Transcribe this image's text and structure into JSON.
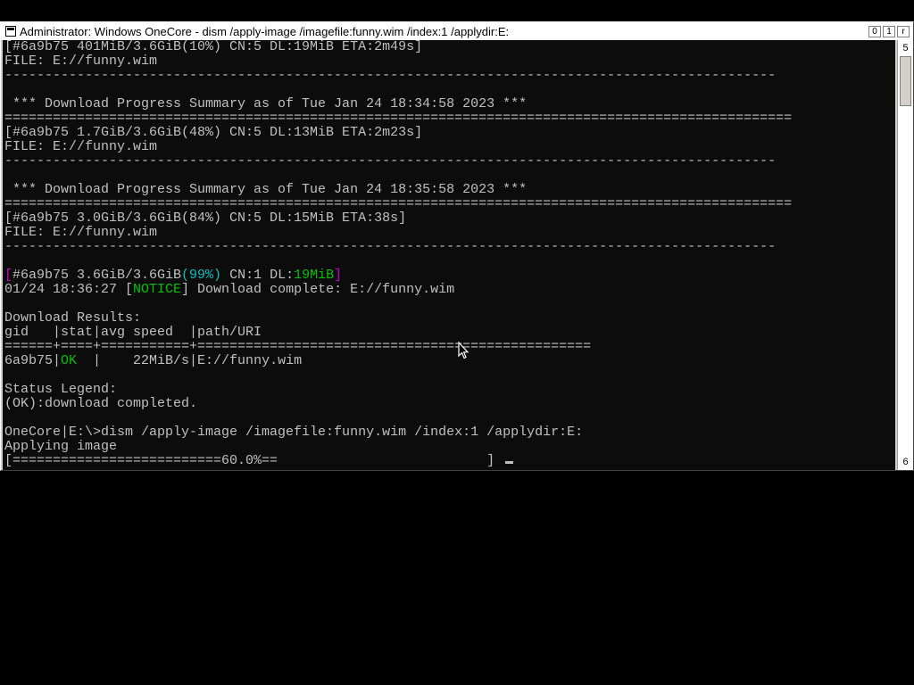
{
  "window": {
    "title": "Administrator:  Windows OneCore - dism  /apply-image /imagefile:funny.wim /index:1 /applydir:E:",
    "buttons": [
      "0",
      "1",
      "r"
    ]
  },
  "scrollbar": {
    "top_label": "5",
    "bottom_label": "6"
  },
  "console": {
    "lines": [
      [
        {
          "t": "[#6a9b75 401MiB/3.6GiB(10%) CN:5 DL:19MiB ETA:2m49s]",
          "c": ""
        }
      ],
      [
        {
          "t": "FILE: E://funny.wim",
          "c": ""
        }
      ],
      [
        {
          "t": "------------------------------------------------------------------------------------------------",
          "c": ""
        }
      ],
      [
        {
          "t": "",
          "c": ""
        }
      ],
      [
        {
          "t": " *** Download Progress Summary as of Tue Jan 24 18:34:58 2023 ***",
          "c": ""
        }
      ],
      [
        {
          "t": "==================================================================================================",
          "c": ""
        }
      ],
      [
        {
          "t": "[#6a9b75 1.7GiB/3.6GiB(48%) CN:5 DL:13MiB ETA:2m23s]",
          "c": ""
        }
      ],
      [
        {
          "t": "FILE: E://funny.wim",
          "c": ""
        }
      ],
      [
        {
          "t": "------------------------------------------------------------------------------------------------",
          "c": ""
        }
      ],
      [
        {
          "t": "",
          "c": ""
        }
      ],
      [
        {
          "t": " *** Download Progress Summary as of Tue Jan 24 18:35:58 2023 ***",
          "c": ""
        }
      ],
      [
        {
          "t": "==================================================================================================",
          "c": ""
        }
      ],
      [
        {
          "t": "[#6a9b75 3.0GiB/3.6GiB(84%) CN:5 DL:15MiB ETA:38s]",
          "c": ""
        }
      ],
      [
        {
          "t": "FILE: E://funny.wim",
          "c": ""
        }
      ],
      [
        {
          "t": "------------------------------------------------------------------------------------------------",
          "c": ""
        }
      ],
      [
        {
          "t": "",
          "c": ""
        }
      ],
      [
        {
          "t": "[",
          "c": "c-magenta"
        },
        {
          "t": "#6a9b75 3.6GiB/3.6GiB",
          "c": ""
        },
        {
          "t": "(99%)",
          "c": "c-cyan"
        },
        {
          "t": " CN:1 DL:",
          "c": ""
        },
        {
          "t": "19MiB",
          "c": "c-green"
        },
        {
          "t": "]",
          "c": "c-magenta"
        }
      ],
      [
        {
          "t": "01/24 18:36:27 [",
          "c": ""
        },
        {
          "t": "NOTICE",
          "c": "c-green"
        },
        {
          "t": "] Download complete: E://funny.wim",
          "c": ""
        }
      ],
      [
        {
          "t": "",
          "c": ""
        }
      ],
      [
        {
          "t": "Download Results:",
          "c": ""
        }
      ],
      [
        {
          "t": "gid   |stat|avg speed  |path/URI",
          "c": ""
        }
      ],
      [
        {
          "t": "======+====+===========+=================================================",
          "c": ""
        }
      ],
      [
        {
          "t": "6a9b75|",
          "c": ""
        },
        {
          "t": "OK",
          "c": "c-green"
        },
        {
          "t": "  |    22MiB/s|E://funny.wim",
          "c": ""
        }
      ],
      [
        {
          "t": "",
          "c": ""
        }
      ],
      [
        {
          "t": "Status Legend:",
          "c": ""
        }
      ],
      [
        {
          "t": "(OK):download completed.",
          "c": ""
        }
      ],
      [
        {
          "t": "",
          "c": ""
        }
      ],
      [
        {
          "t": "OneCore|E:\\>dism /apply-image /imagefile:funny.wim /index:1 /applydir:E:",
          "c": ""
        }
      ],
      [
        {
          "t": "Applying image",
          "c": ""
        }
      ],
      [
        {
          "t": "[==========================60.0%==                          ]",
          "c": ""
        }
      ]
    ],
    "progress_percent": 60.0
  },
  "colors": {
    "console_bg": "#0c0c0c",
    "console_text": "#c0c0c0",
    "magenta": "#c000c0",
    "cyan": "#00c0c0",
    "green": "#00c000"
  },
  "icons": {
    "system_menu": "console-icon",
    "pointer": "mouse-pointer-icon"
  }
}
